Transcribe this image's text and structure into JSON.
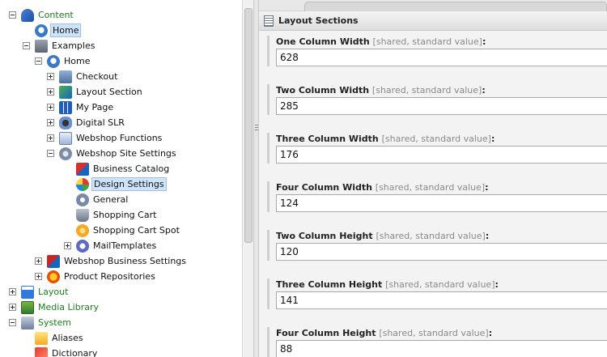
{
  "tree": {
    "items": [
      {
        "label": "Content",
        "icon": "content-icon",
        "toggle": "minus",
        "level": 0,
        "green": true
      },
      {
        "label": "Home",
        "icon": "home-icon",
        "toggle": "",
        "level": 1,
        "selected": true
      },
      {
        "label": "Examples",
        "icon": "examples-icon",
        "toggle": "minus",
        "level": 1
      },
      {
        "label": "Home",
        "icon": "home-icon",
        "toggle": "minus",
        "level": 2
      },
      {
        "label": "Checkout",
        "icon": "checkout-icon",
        "toggle": "plus",
        "level": 3
      },
      {
        "label": "Layout Section",
        "icon": "layout-section-icon",
        "toggle": "plus",
        "level": 3
      },
      {
        "label": "My Page",
        "icon": "my-page-icon",
        "toggle": "plus",
        "level": 3
      },
      {
        "label": "Digital SLR",
        "icon": "camera-icon",
        "toggle": "plus",
        "level": 3
      },
      {
        "label": "Webshop Functions",
        "icon": "functions-icon",
        "toggle": "plus",
        "level": 3
      },
      {
        "label": "Webshop Site Settings",
        "icon": "gear-icon",
        "toggle": "minus",
        "level": 3
      },
      {
        "label": "Business Catalog",
        "icon": "catalog-icon",
        "toggle": "",
        "level": 4
      },
      {
        "label": "Design Settings",
        "icon": "design-icon",
        "toggle": "",
        "level": 4,
        "selected": true
      },
      {
        "label": "General",
        "icon": "general-icon",
        "toggle": "",
        "level": 4
      },
      {
        "label": "Shopping Cart",
        "icon": "cart-icon",
        "toggle": "",
        "level": 4
      },
      {
        "label": "Shopping Cart Spot",
        "icon": "cart-spot-icon",
        "toggle": "",
        "level": 4
      },
      {
        "label": "MailTemplates",
        "icon": "mail-icon",
        "toggle": "plus",
        "level": 4
      },
      {
        "label": "Webshop Business Settings",
        "icon": "business-icon",
        "toggle": "plus",
        "level": 2
      },
      {
        "label": "Product Repositories",
        "icon": "product-icon",
        "toggle": "plus",
        "level": 2
      },
      {
        "label": "Layout",
        "icon": "layout-icon",
        "toggle": "plus",
        "level": 0,
        "green": true
      },
      {
        "label": "Media Library",
        "icon": "media-library-icon",
        "toggle": "plus",
        "level": 0,
        "green": true
      },
      {
        "label": "System",
        "icon": "system-icon",
        "toggle": "minus",
        "level": 0,
        "green": true
      },
      {
        "label": "Aliases",
        "icon": "aliases-icon",
        "toggle": "",
        "level": 1
      },
      {
        "label": "Dictionary",
        "icon": "dictionary-icon",
        "toggle": "",
        "level": 1
      }
    ]
  },
  "section": {
    "title": "Layout Sections"
  },
  "fields": [
    {
      "label": "One Column Width",
      "hint": "[shared, standard value]",
      "value": "628"
    },
    {
      "label": "Two Column Width",
      "hint": "[shared, standard value]",
      "value": "285"
    },
    {
      "label": "Three Column Width",
      "hint": "[shared, standard value]",
      "value": "176"
    },
    {
      "label": "Four Column Width",
      "hint": "[shared, standard value]",
      "value": "124"
    },
    {
      "label": "Two Column Height",
      "hint": "[shared, standard value]",
      "value": "120"
    },
    {
      "label": "Three Column Height",
      "hint": "[shared, standard value]",
      "value": "141"
    },
    {
      "label": "Four Column Height",
      "hint": "[shared, standard value]",
      "value": "88"
    }
  ],
  "colors": {
    "tree_green_label": "#1a7f1a",
    "selection_bg": "#cfe3f8",
    "content_bg": "#f3f3f3"
  }
}
